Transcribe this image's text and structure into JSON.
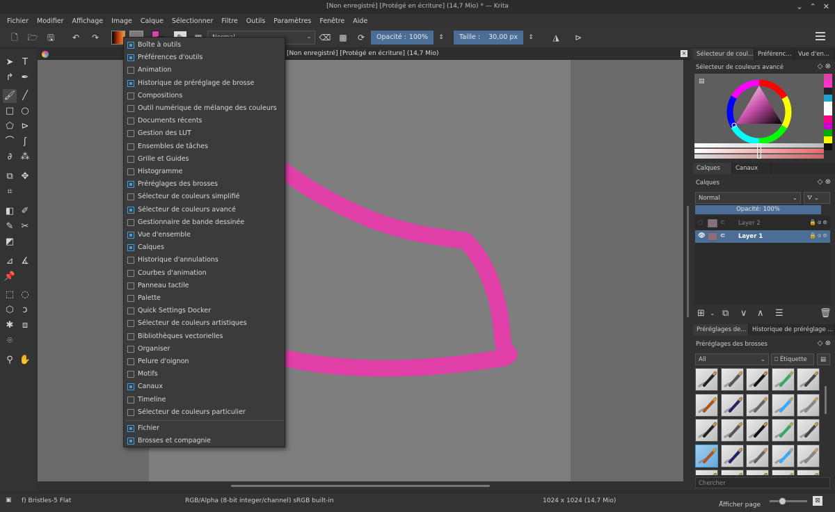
{
  "window": {
    "title": "[Non enregistré] [Protégé en écriture] (14,7 Mio) * — Krita"
  },
  "menubar": [
    "Fichier",
    "Modifier",
    "Affichage",
    "Image",
    "Calque",
    "Sélectionner",
    "Filtre",
    "Outils",
    "Paramètres",
    "Fenêtre",
    "Aide"
  ],
  "toolbar": {
    "blend_mode": "Normal",
    "opacity_label": "Opacité :",
    "opacity_value": "100%",
    "size_label": "Taille :",
    "size_value": "30,00 px",
    "fg_color": "#e040a8",
    "bg_color": "#ffffff"
  },
  "document": {
    "tab_title": "[Non enregistré]  [Protégé en écriture]  (14,7 Mio)",
    "stroke_color": "#e040a8"
  },
  "docker_menu": {
    "items": [
      {
        "label": "Boîte à outils",
        "checked": true
      },
      {
        "label": "Préférences d'outils",
        "checked": true
      },
      {
        "label": "Animation",
        "checked": false
      },
      {
        "label": "Historique de préréglage de brosse",
        "checked": true
      },
      {
        "label": "Compositions",
        "checked": false
      },
      {
        "label": "Outil numérique de mélange des couleurs",
        "checked": false
      },
      {
        "label": "Documents récents",
        "checked": false
      },
      {
        "label": "Gestion des LUT",
        "checked": false
      },
      {
        "label": "Ensembles de tâches",
        "checked": false
      },
      {
        "label": "Grille et Guides",
        "checked": false
      },
      {
        "label": "Histogramme",
        "checked": false
      },
      {
        "label": "Préréglages des brosses",
        "checked": true
      },
      {
        "label": "Sélecteur de couleurs simplifié",
        "checked": false
      },
      {
        "label": "Sélecteur de couleurs avancé",
        "checked": true
      },
      {
        "label": "Gestionnaire de bande dessinée",
        "checked": false
      },
      {
        "label": "Vue d'ensemble",
        "checked": true
      },
      {
        "label": "Calques",
        "checked": true
      },
      {
        "label": "Historique d'annulations",
        "checked": false
      },
      {
        "label": "Courbes d'animation",
        "checked": false
      },
      {
        "label": "Panneau tactile",
        "checked": false
      },
      {
        "label": "Palette",
        "checked": false
      },
      {
        "label": "Quick Settings Docker",
        "checked": false
      },
      {
        "label": "Sélecteur de couleurs artistiques",
        "checked": false
      },
      {
        "label": "Bibliothèques vectorielles",
        "checked": false
      },
      {
        "label": "Organiser",
        "checked": false
      },
      {
        "label": "Pelure d'oignon",
        "checked": false
      },
      {
        "label": "Motifs",
        "checked": false
      },
      {
        "label": "Canaux",
        "checked": true
      },
      {
        "label": "Timeline",
        "checked": false
      },
      {
        "label": "Sélecteur de couleurs particulier",
        "checked": false
      }
    ],
    "toolbar_items": [
      {
        "label": "Fichier",
        "checked": true
      },
      {
        "label": "Brosses et compagnie",
        "checked": true
      }
    ]
  },
  "right_panel": {
    "top_tabs": [
      "Sélecteur de coul...",
      "Préférenc...",
      "Vue d'en..."
    ],
    "color_selector_title": "Sélecteur de couleurs avancé",
    "layer_tabs": [
      "Calques",
      "Canaux"
    ],
    "layers_title": "Calques",
    "layer_blend": "Normal",
    "layer_opacity": "Opacité:  100%",
    "layers": [
      {
        "name": "Layer 2",
        "selected": false
      },
      {
        "name": "Layer 1",
        "selected": true
      }
    ],
    "brush_tabs": [
      "Préréglages de...",
      "Historique de préréglage ..."
    ],
    "brush_title": "Préréglages des brosses",
    "brush_filter": "All",
    "brush_tag_button": "Étiquette",
    "brush_search_placeholder": "Chercher",
    "palette": [
      "#e040a8",
      "#f3c",
      "#222",
      "#1fa3c9",
      "#fff",
      "#fff",
      "#f08",
      "#c0c",
      "#0a0",
      "#ff0",
      "#111"
    ]
  },
  "statusbar": {
    "brush": "f) Bristles-5 Flat",
    "colorspace": "RGB/Alpha (8-bit integer/channel)  sRGB built-in",
    "dimensions": "1024 x 1024 (14,7 Mio)",
    "view_mode": "Afficher page"
  }
}
